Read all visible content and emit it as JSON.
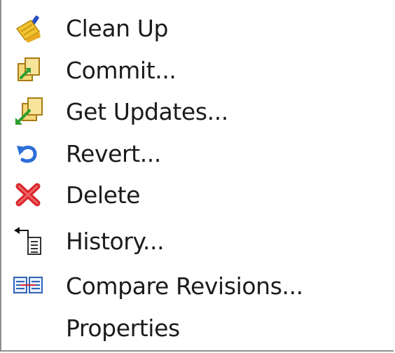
{
  "menu": {
    "items": [
      {
        "label": "Clean Up",
        "icon": "broom-icon"
      },
      {
        "label": "Commit...",
        "icon": "commit-icon"
      },
      {
        "label": "Get Updates...",
        "icon": "get-updates-icon"
      },
      {
        "label": "Revert...",
        "icon": "revert-icon"
      },
      {
        "label": "Delete",
        "icon": "delete-icon"
      },
      {
        "label": "History...",
        "icon": "history-icon"
      },
      {
        "label": "Compare Revisions...",
        "icon": "compare-icon"
      },
      {
        "label": "Properties",
        "icon": ""
      }
    ]
  }
}
